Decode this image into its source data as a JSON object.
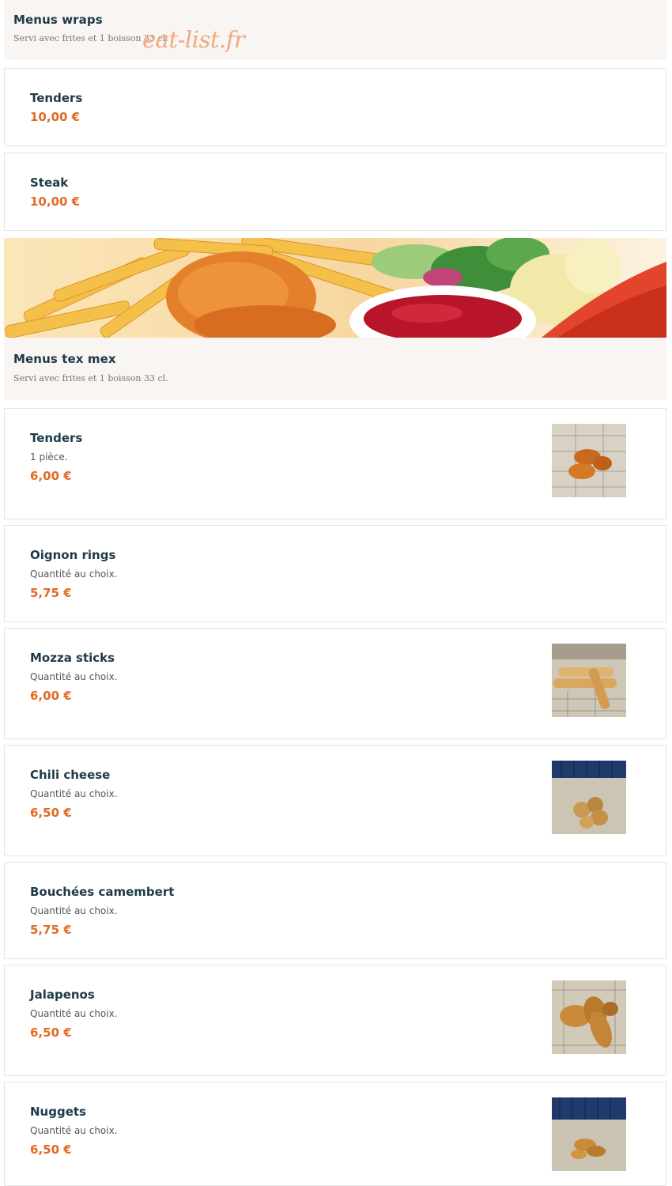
{
  "watermark": "eat-list.fr",
  "section_wraps": {
    "title": "Menus wraps",
    "subtitle": "Servi avec frites et 1 boisson 33 cl."
  },
  "wraps_items": [
    {
      "name": "Tenders",
      "price": "10,00 €"
    },
    {
      "name": "Steak",
      "price": "10,00 €"
    }
  ],
  "section_texmex": {
    "title": "Menus tex mex",
    "subtitle": "Servi avec frites et 1 boisson 33 cl."
  },
  "texmex_items": [
    {
      "name": "Tenders",
      "desc": "1 pièce.",
      "price": "6,00 €",
      "image": "tenders-photo"
    },
    {
      "name": "Oignon rings",
      "desc": "Quantité au choix.",
      "price": "5,75 €"
    },
    {
      "name": "Mozza sticks",
      "desc": "Quantité au choix.",
      "price": "6,00 €",
      "image": "mozza-sticks-photo"
    },
    {
      "name": "Chili cheese",
      "desc": "Quantité au choix.",
      "price": "6,50 €",
      "image": "chili-cheese-photo"
    },
    {
      "name": "Bouchées camembert",
      "desc": "Quantité au choix.",
      "price": "5,75 €"
    },
    {
      "name": "Jalapenos",
      "desc": "Quantité au choix.",
      "price": "6,50 €",
      "image": "jalapenos-photo"
    },
    {
      "name": "Nuggets",
      "desc": "Quantité au choix.",
      "price": "6,50 €",
      "image": "nuggets-photo"
    }
  ],
  "colors": {
    "title": "#1e3a4a",
    "price": "#e26b21",
    "header_bg": "#f8f5f2",
    "watermark": "#f0a981"
  }
}
